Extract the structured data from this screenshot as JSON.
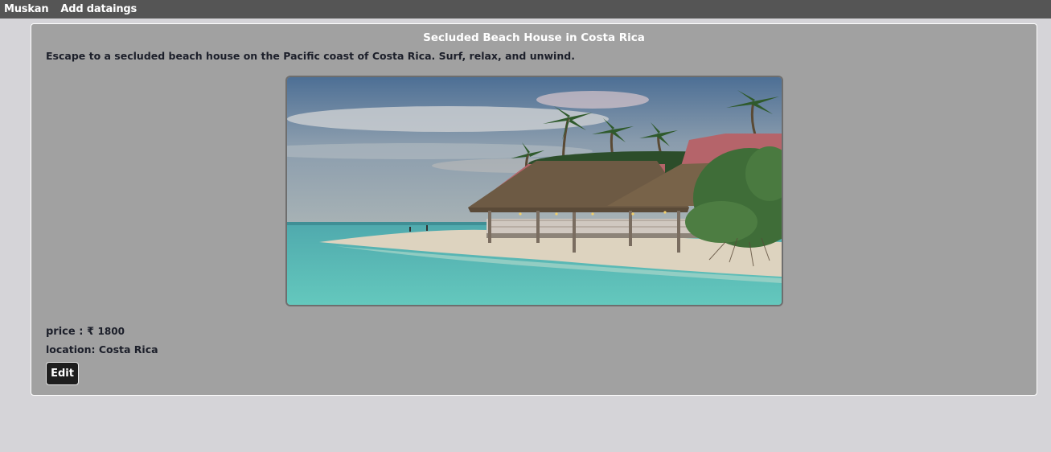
{
  "navbar": {
    "brand": "Muskan",
    "add_link": "Add dataings"
  },
  "listing": {
    "title": "Secluded Beach House in Costa Rica",
    "description": "Escape to a secluded beach house on the Pacific coast of Costa Rica. Surf, relax, and unwind.",
    "price_label": "price : ₹",
    "price_value": "1800",
    "location_label": "location: Costa Rica",
    "image_alt": "Beach house with thatched roof on the shore among palm trees",
    "edit_label": "Edit"
  },
  "colors": {
    "navbar": "#555555",
    "page_bg": "#d5d4d8",
    "card_bg": "#a1a1a1",
    "button_bg": "#1e1e1e"
  }
}
